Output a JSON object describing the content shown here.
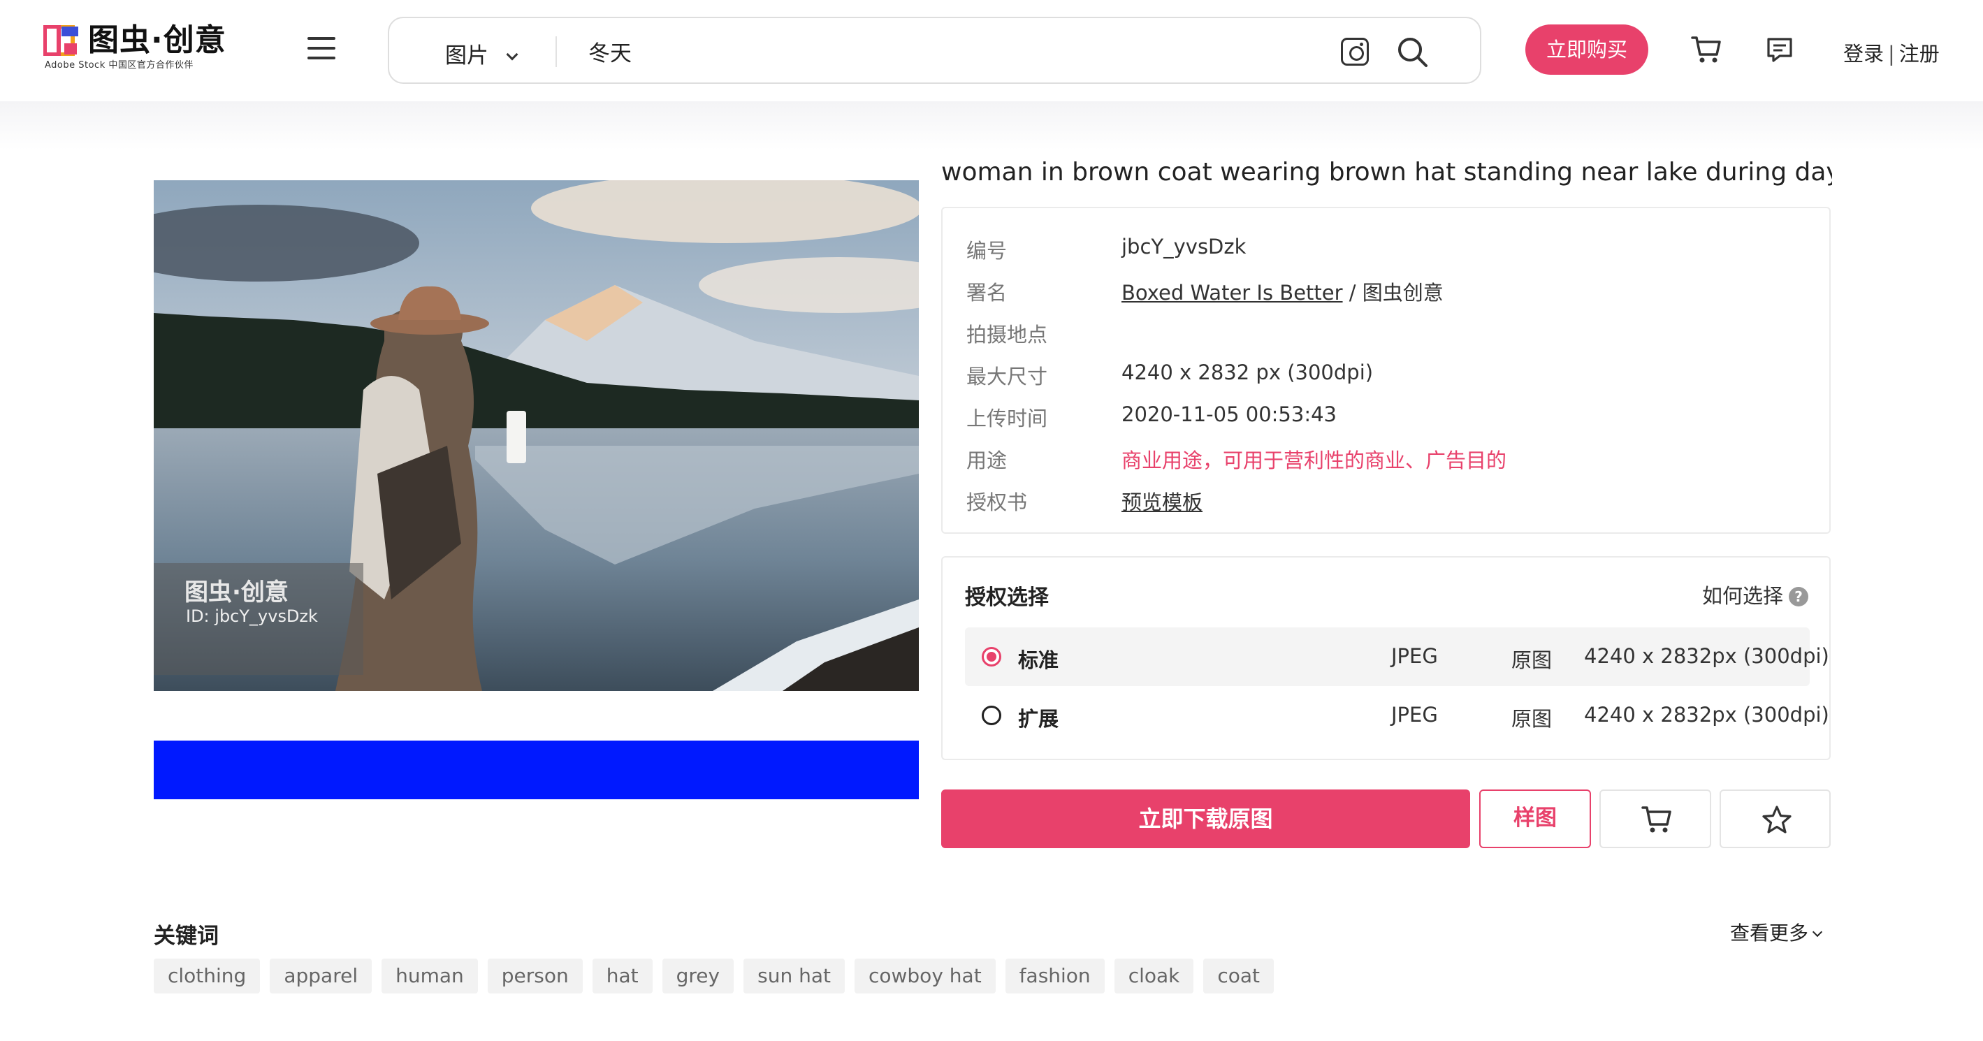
{
  "header": {
    "logo_text": "图虫·创意",
    "logo_subtitle": "Adobe  Stock 中国区官方合作伙伴",
    "search_type": "图片",
    "search_value": "冬天",
    "buy_button": "立即购买",
    "login": "登录",
    "separator": "|",
    "register": "注册"
  },
  "image": {
    "watermark_logo": "图虫·创意",
    "watermark_id": "ID: jbcY_yvsDzk"
  },
  "detail": {
    "title": "woman in brown coat wearing brown hat standing near lake during daytim...",
    "rows": [
      {
        "label": "编号",
        "value": "jbcY_yvsDzk"
      },
      {
        "label": "署名",
        "author": "Boxed Water Is Better",
        "suffix": " / 图虫创意"
      },
      {
        "label": "拍摄地点",
        "value": ""
      },
      {
        "label": "最大尺寸",
        "value": "4240 x 2832 px (300dpi)"
      },
      {
        "label": "上传时间",
        "value": "2020-11-05 00:53:43"
      },
      {
        "label": "用途",
        "value": "商业用途，可用于营利性的商业、广告目的"
      },
      {
        "label": "授权书",
        "value": "预览模板"
      }
    ]
  },
  "license": {
    "title": "授权选择",
    "help": "如何选择",
    "help_icon": "?",
    "options": [
      {
        "name": "标准",
        "format": "JPEG",
        "type": "原图",
        "size": "4240 x 2832px (300dpi)",
        "selected": true
      },
      {
        "name": "扩展",
        "format": "JPEG",
        "type": "原图",
        "size": "4240 x 2832px (300dpi)",
        "selected": false
      }
    ]
  },
  "actions": {
    "download": "立即下载原图",
    "sample": "样图",
    "cart_icon": "cart-icon",
    "favorite_icon": "star-icon"
  },
  "keywords": {
    "title": "关键词",
    "more": "查看更多",
    "tags": [
      "clothing",
      "apparel",
      "human",
      "person",
      "hat",
      "grey",
      "sun hat",
      "cowboy hat",
      "fashion",
      "cloak",
      "coat"
    ]
  },
  "colors": {
    "accent": "#e8416b",
    "blue_bar": "#0019ff"
  }
}
